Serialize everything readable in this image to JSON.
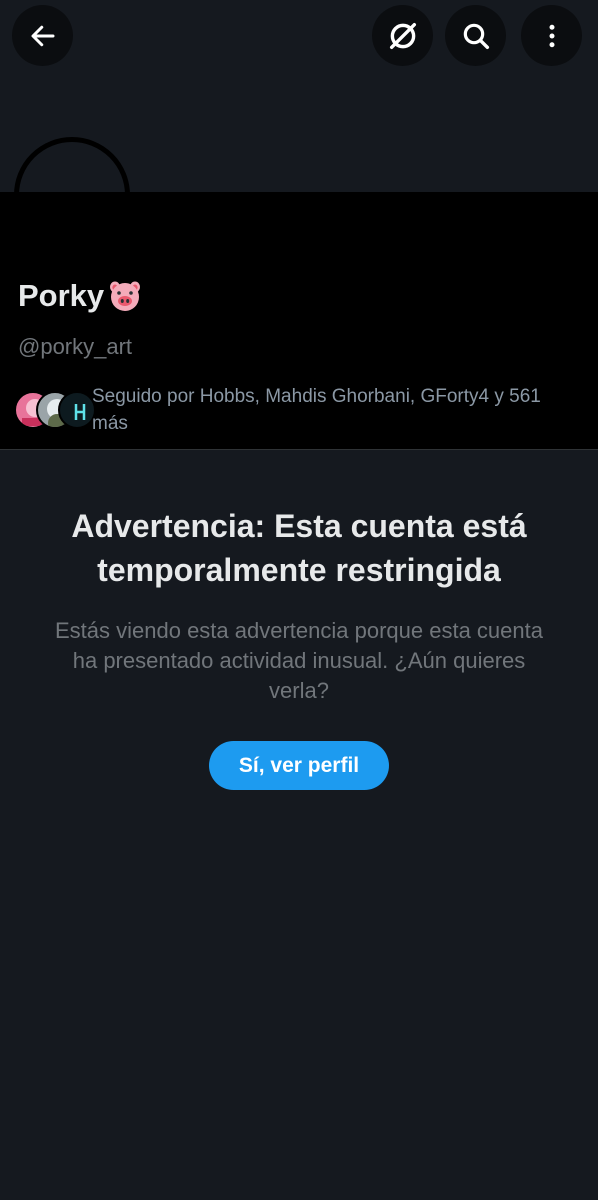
{
  "header": {
    "back_icon": "arrow-left-icon",
    "grok_icon": "slash-circle-icon",
    "search_icon": "search-icon",
    "more_icon": "more-vertical-icon"
  },
  "profile": {
    "display_name": "Porky",
    "name_emoji": "pig-face-icon",
    "handle": "@porky_art",
    "followed_by": "Seguido por Hobbs, Mahdis Ghorbani, GForty4 y 561 más"
  },
  "warning": {
    "title": "Advertencia: Esta cuenta está temporalmente restringida",
    "body": "Estás viendo esta advertencia porque esta cuenta ha presentado actividad inusual. ¿Aún quieres verla?",
    "button_label": "Sí, ver perfil"
  },
  "colors": {
    "background": "#15191f",
    "profile_block": "#000000",
    "accent": "#1d9bf0",
    "muted_text": "#71767b"
  }
}
